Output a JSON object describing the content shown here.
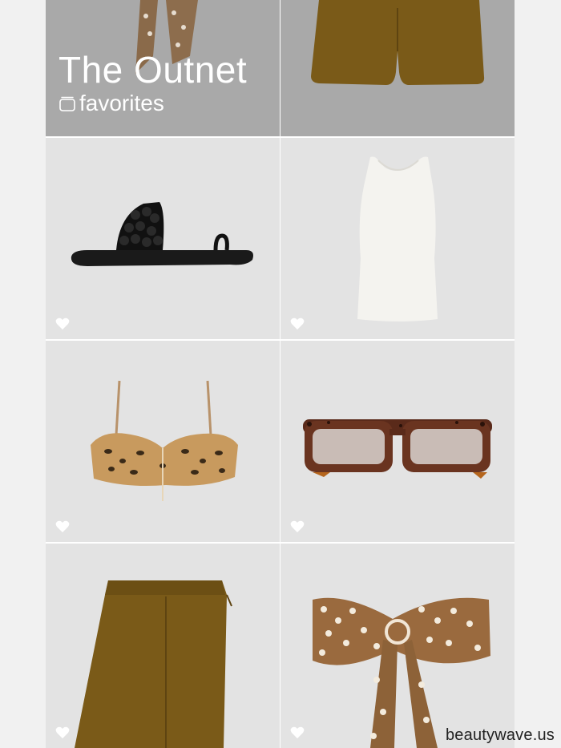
{
  "header": {
    "brand": "The Outnet",
    "subtitle": "favorites",
    "icon": "folder-icon"
  },
  "products": [
    {
      "name": "scarf-top-product",
      "icon": "heart-icon"
    },
    {
      "name": "olive-shorts-product",
      "icon": "heart-icon"
    },
    {
      "name": "black-sandal",
      "icon": "heart-icon"
    },
    {
      "name": "white-tank-top",
      "icon": "heart-icon"
    },
    {
      "name": "leopard-bikini-top",
      "icon": "heart-icon"
    },
    {
      "name": "tortoiseshell-sunglasses",
      "icon": "heart-icon"
    },
    {
      "name": "olive-shorts",
      "icon": "heart-icon"
    },
    {
      "name": "polka-dot-bandeau-top",
      "icon": "heart-icon"
    }
  ],
  "watermark": "beautywave.us",
  "colors": {
    "page_bg": "#f1f1f1",
    "card_bg": "#e3e3e3",
    "header_overlay": "#a9a9a9",
    "text_light": "#ffffff"
  }
}
